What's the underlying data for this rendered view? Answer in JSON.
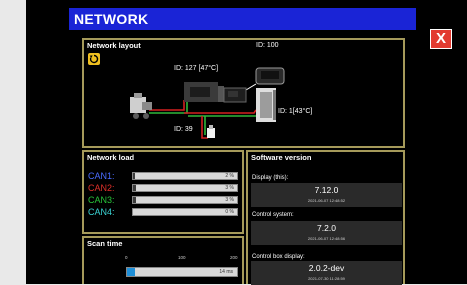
{
  "window": {
    "title": "NETWORK",
    "close_label": "X"
  },
  "network_layout": {
    "title": "Network layout",
    "nodes": [
      {
        "label": "ID: 100"
      },
      {
        "label": "ID: 127 [47°C]"
      },
      {
        "label": "ID: 1[43°C]"
      },
      {
        "label": "ID: 39"
      }
    ],
    "colors": {
      "red": "#d42020",
      "green": "#2fb83a",
      "wire": "#ffffff"
    }
  },
  "network_load": {
    "title": "Network load",
    "channels": [
      {
        "name": "CAN1:",
        "color": "#4a6cff",
        "value_label": "2 %",
        "percent": 2
      },
      {
        "name": "CAN2:",
        "color": "#e0302a",
        "value_label": "3 %",
        "percent": 3
      },
      {
        "name": "CAN3:",
        "color": "#27c43a",
        "value_label": "3 %",
        "percent": 3
      },
      {
        "name": "CAN4:",
        "color": "#3ad4d4",
        "value_label": "0 %",
        "percent": 0
      }
    ]
  },
  "scan_time": {
    "title": "Scan time",
    "ticks": [
      "0",
      "100",
      "200"
    ],
    "value_label": "14 ms",
    "value_ms": 14,
    "max_ms": 200
  },
  "software_version": {
    "title": "Software version",
    "items": [
      {
        "label": "Display (this):",
        "version": "7.12.0",
        "date": "2021-06-07 12:48:52"
      },
      {
        "label": "Control system:",
        "version": "7.2.0",
        "date": "2021-06-07 12:48:56"
      },
      {
        "label": "Control box display:",
        "version": "2.0.2-dev",
        "date": "2021-07-30 11:28:59"
      }
    ]
  }
}
